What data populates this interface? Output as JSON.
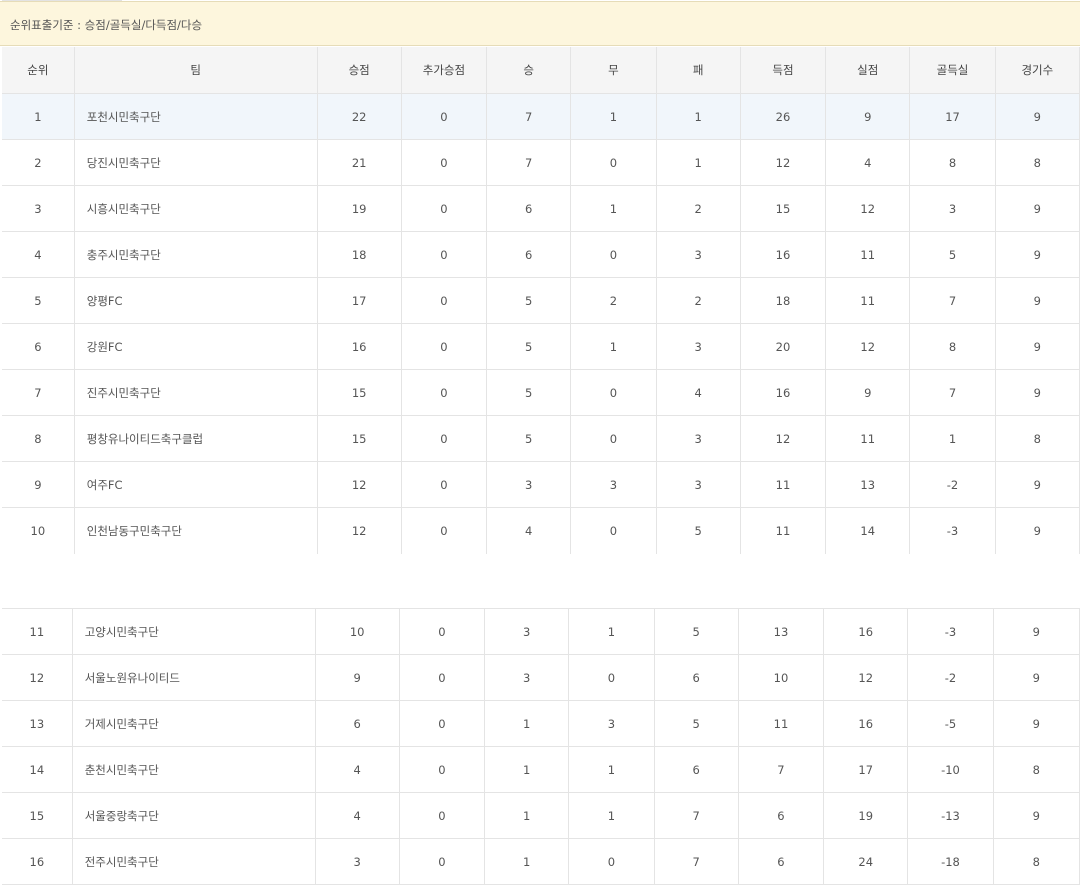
{
  "notice": "순위표출기준 : 승점/골득실/다득점/다승",
  "headers": [
    "순위",
    "팀",
    "승점",
    "추가승점",
    "승",
    "무",
    "패",
    "득점",
    "실점",
    "골득실",
    "경기수"
  ],
  "rows_top": [
    [
      "1",
      "포천시민축구단",
      "22",
      "0",
      "7",
      "1",
      "1",
      "26",
      "9",
      "17",
      "9"
    ],
    [
      "2",
      "당진시민축구단",
      "21",
      "0",
      "7",
      "0",
      "1",
      "12",
      "4",
      "8",
      "8"
    ],
    [
      "3",
      "시흥시민축구단",
      "19",
      "0",
      "6",
      "1",
      "2",
      "15",
      "12",
      "3",
      "9"
    ],
    [
      "4",
      "충주시민축구단",
      "18",
      "0",
      "6",
      "0",
      "3",
      "16",
      "11",
      "5",
      "9"
    ],
    [
      "5",
      "양평FC",
      "17",
      "0",
      "5",
      "2",
      "2",
      "18",
      "11",
      "7",
      "9"
    ],
    [
      "6",
      "강원FC",
      "16",
      "0",
      "5",
      "1",
      "3",
      "20",
      "12",
      "8",
      "9"
    ],
    [
      "7",
      "진주시민축구단",
      "15",
      "0",
      "5",
      "0",
      "4",
      "16",
      "9",
      "7",
      "9"
    ],
    [
      "8",
      "평창유나이티드축구클럽",
      "15",
      "0",
      "5",
      "0",
      "3",
      "12",
      "11",
      "1",
      "8"
    ],
    [
      "9",
      "여주FC",
      "12",
      "0",
      "3",
      "3",
      "3",
      "11",
      "13",
      "-2",
      "9"
    ],
    [
      "10",
      "인천남동구민축구단",
      "12",
      "0",
      "4",
      "0",
      "5",
      "11",
      "14",
      "-3",
      "9"
    ]
  ],
  "rows_bottom": [
    [
      "11",
      "고양시민축구단",
      "10",
      "0",
      "3",
      "1",
      "5",
      "13",
      "16",
      "-3",
      "9"
    ],
    [
      "12",
      "서울노원유나이티드",
      "9",
      "0",
      "3",
      "0",
      "6",
      "10",
      "12",
      "-2",
      "9"
    ],
    [
      "13",
      "거제시민축구단",
      "6",
      "0",
      "1",
      "3",
      "5",
      "11",
      "16",
      "-5",
      "9"
    ],
    [
      "14",
      "춘천시민축구단",
      "4",
      "0",
      "1",
      "1",
      "6",
      "7",
      "17",
      "-10",
      "8"
    ],
    [
      "15",
      "서울중랑축구단",
      "4",
      "0",
      "1",
      "1",
      "7",
      "6",
      "19",
      "-13",
      "9"
    ],
    [
      "16",
      "전주시민축구단",
      "3",
      "0",
      "1",
      "0",
      "7",
      "6",
      "24",
      "-18",
      "8"
    ]
  ]
}
